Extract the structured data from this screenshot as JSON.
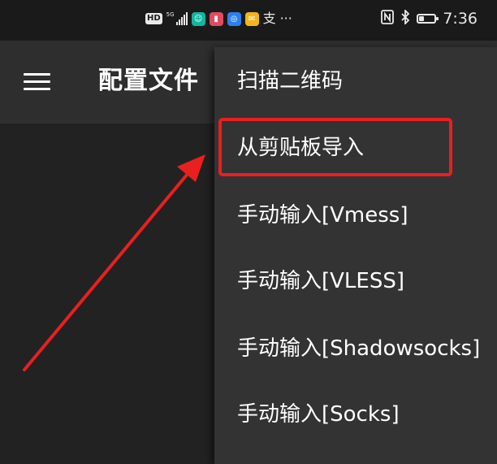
{
  "status_bar": {
    "hd_label": "HD",
    "network_label": "5G",
    "app_icons": [
      {
        "icon": "wechat-app-icon",
        "color": "#12b5a0"
      },
      {
        "icon": "book-app-icon",
        "color": "#e24b5e"
      },
      {
        "icon": "alarm-app-icon",
        "color": "#2d7ff0"
      },
      {
        "icon": "mail-app-icon",
        "color": "#f2b51a"
      }
    ],
    "alipay_glyph": "支",
    "more_glyph": "···",
    "battery_level": 0.35,
    "time": "7:36"
  },
  "toolbar": {
    "title": "配置文件",
    "menu_icon": "hamburger-icon"
  },
  "menu": {
    "items": [
      {
        "label": "扫描二维码"
      },
      {
        "label": "从剪贴板导入"
      },
      {
        "label": "手动输入[Vmess]"
      },
      {
        "label": "手动输入[VLESS]"
      },
      {
        "label": "手动输入[Shadowsocks]"
      },
      {
        "label": "手动输入[Socks]"
      }
    ]
  },
  "annotation": {
    "highlight_color": "#e8201f",
    "arrow_color": "#e8201f"
  }
}
